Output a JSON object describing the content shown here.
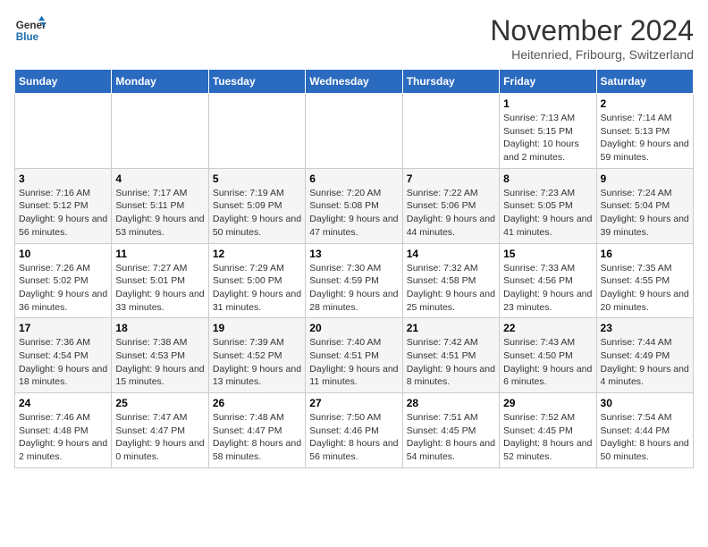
{
  "logo": {
    "line1": "General",
    "line2": "Blue"
  },
  "title": "November 2024",
  "location": "Heitenried, Fribourg, Switzerland",
  "days_of_week": [
    "Sunday",
    "Monday",
    "Tuesday",
    "Wednesday",
    "Thursday",
    "Friday",
    "Saturday"
  ],
  "weeks": [
    [
      {
        "day": "",
        "info": ""
      },
      {
        "day": "",
        "info": ""
      },
      {
        "day": "",
        "info": ""
      },
      {
        "day": "",
        "info": ""
      },
      {
        "day": "",
        "info": ""
      },
      {
        "day": "1",
        "info": "Sunrise: 7:13 AM\nSunset: 5:15 PM\nDaylight: 10 hours and 2 minutes."
      },
      {
        "day": "2",
        "info": "Sunrise: 7:14 AM\nSunset: 5:13 PM\nDaylight: 9 hours and 59 minutes."
      }
    ],
    [
      {
        "day": "3",
        "info": "Sunrise: 7:16 AM\nSunset: 5:12 PM\nDaylight: 9 hours and 56 minutes."
      },
      {
        "day": "4",
        "info": "Sunrise: 7:17 AM\nSunset: 5:11 PM\nDaylight: 9 hours and 53 minutes."
      },
      {
        "day": "5",
        "info": "Sunrise: 7:19 AM\nSunset: 5:09 PM\nDaylight: 9 hours and 50 minutes."
      },
      {
        "day": "6",
        "info": "Sunrise: 7:20 AM\nSunset: 5:08 PM\nDaylight: 9 hours and 47 minutes."
      },
      {
        "day": "7",
        "info": "Sunrise: 7:22 AM\nSunset: 5:06 PM\nDaylight: 9 hours and 44 minutes."
      },
      {
        "day": "8",
        "info": "Sunrise: 7:23 AM\nSunset: 5:05 PM\nDaylight: 9 hours and 41 minutes."
      },
      {
        "day": "9",
        "info": "Sunrise: 7:24 AM\nSunset: 5:04 PM\nDaylight: 9 hours and 39 minutes."
      }
    ],
    [
      {
        "day": "10",
        "info": "Sunrise: 7:26 AM\nSunset: 5:02 PM\nDaylight: 9 hours and 36 minutes."
      },
      {
        "day": "11",
        "info": "Sunrise: 7:27 AM\nSunset: 5:01 PM\nDaylight: 9 hours and 33 minutes."
      },
      {
        "day": "12",
        "info": "Sunrise: 7:29 AM\nSunset: 5:00 PM\nDaylight: 9 hours and 31 minutes."
      },
      {
        "day": "13",
        "info": "Sunrise: 7:30 AM\nSunset: 4:59 PM\nDaylight: 9 hours and 28 minutes."
      },
      {
        "day": "14",
        "info": "Sunrise: 7:32 AM\nSunset: 4:58 PM\nDaylight: 9 hours and 25 minutes."
      },
      {
        "day": "15",
        "info": "Sunrise: 7:33 AM\nSunset: 4:56 PM\nDaylight: 9 hours and 23 minutes."
      },
      {
        "day": "16",
        "info": "Sunrise: 7:35 AM\nSunset: 4:55 PM\nDaylight: 9 hours and 20 minutes."
      }
    ],
    [
      {
        "day": "17",
        "info": "Sunrise: 7:36 AM\nSunset: 4:54 PM\nDaylight: 9 hours and 18 minutes."
      },
      {
        "day": "18",
        "info": "Sunrise: 7:38 AM\nSunset: 4:53 PM\nDaylight: 9 hours and 15 minutes."
      },
      {
        "day": "19",
        "info": "Sunrise: 7:39 AM\nSunset: 4:52 PM\nDaylight: 9 hours and 13 minutes."
      },
      {
        "day": "20",
        "info": "Sunrise: 7:40 AM\nSunset: 4:51 PM\nDaylight: 9 hours and 11 minutes."
      },
      {
        "day": "21",
        "info": "Sunrise: 7:42 AM\nSunset: 4:51 PM\nDaylight: 9 hours and 8 minutes."
      },
      {
        "day": "22",
        "info": "Sunrise: 7:43 AM\nSunset: 4:50 PM\nDaylight: 9 hours and 6 minutes."
      },
      {
        "day": "23",
        "info": "Sunrise: 7:44 AM\nSunset: 4:49 PM\nDaylight: 9 hours and 4 minutes."
      }
    ],
    [
      {
        "day": "24",
        "info": "Sunrise: 7:46 AM\nSunset: 4:48 PM\nDaylight: 9 hours and 2 minutes."
      },
      {
        "day": "25",
        "info": "Sunrise: 7:47 AM\nSunset: 4:47 PM\nDaylight: 9 hours and 0 minutes."
      },
      {
        "day": "26",
        "info": "Sunrise: 7:48 AM\nSunset: 4:47 PM\nDaylight: 8 hours and 58 minutes."
      },
      {
        "day": "27",
        "info": "Sunrise: 7:50 AM\nSunset: 4:46 PM\nDaylight: 8 hours and 56 minutes."
      },
      {
        "day": "28",
        "info": "Sunrise: 7:51 AM\nSunset: 4:45 PM\nDaylight: 8 hours and 54 minutes."
      },
      {
        "day": "29",
        "info": "Sunrise: 7:52 AM\nSunset: 4:45 PM\nDaylight: 8 hours and 52 minutes."
      },
      {
        "day": "30",
        "info": "Sunrise: 7:54 AM\nSunset: 4:44 PM\nDaylight: 8 hours and 50 minutes."
      }
    ]
  ]
}
